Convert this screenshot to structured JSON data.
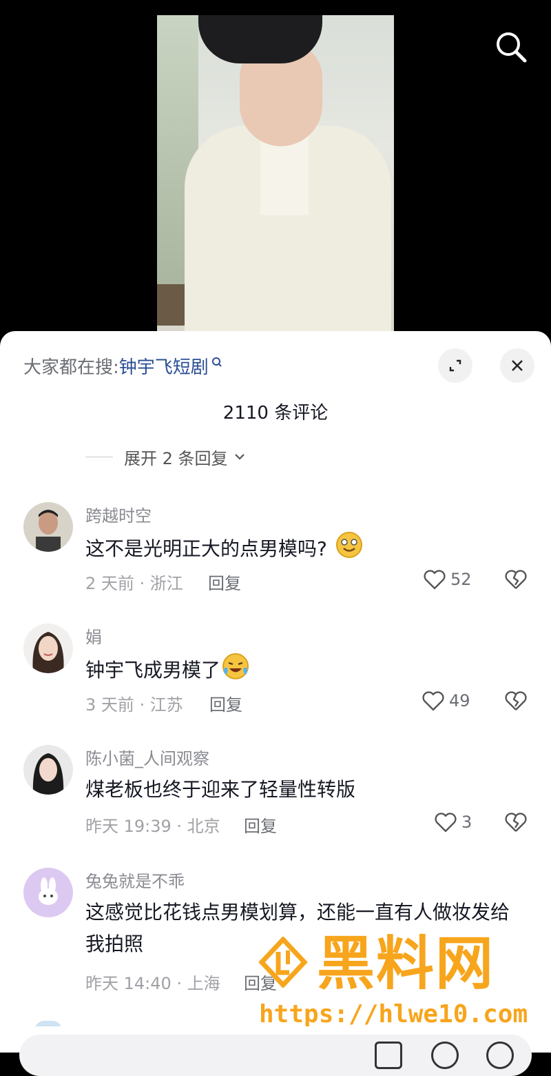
{
  "hot_search": {
    "prefix": "大家都在搜:",
    "term": "钟宇飞短剧"
  },
  "comment_count": "2110 条评论",
  "expand_replies": "展开 2 条回复",
  "comments": [
    {
      "user": "跨越时空",
      "text": "这不是光明正大的点男模吗?",
      "emoji": "grinning-face-icon",
      "time_loc": "2 天前 · 浙江",
      "reply": "回复",
      "likes": "52"
    },
    {
      "user": "娟",
      "text": "钟宇飞成男模了",
      "emoji": "laughing-tears-icon",
      "time_loc": "3 天前 · 江苏",
      "reply": "回复",
      "likes": "49"
    },
    {
      "user": "陈小菌_人间观察",
      "text": "煤老板也终于迎来了轻量性转版",
      "time_loc": "昨天 19:39 · 北京",
      "reply": "回复",
      "likes": "3"
    },
    {
      "user": "兔兔就是不乖",
      "text": "这感觉比花钱点男模划算，还能一直有人做妆发给我拍照",
      "time_loc": "昨天 14:40 · 上海",
      "reply": "回复"
    }
  ],
  "watermark": {
    "title": "黑料网",
    "url": "https://hlwe10.com"
  },
  "colors": {
    "link": "#2a4e95",
    "watermark": "#f7a51c"
  }
}
